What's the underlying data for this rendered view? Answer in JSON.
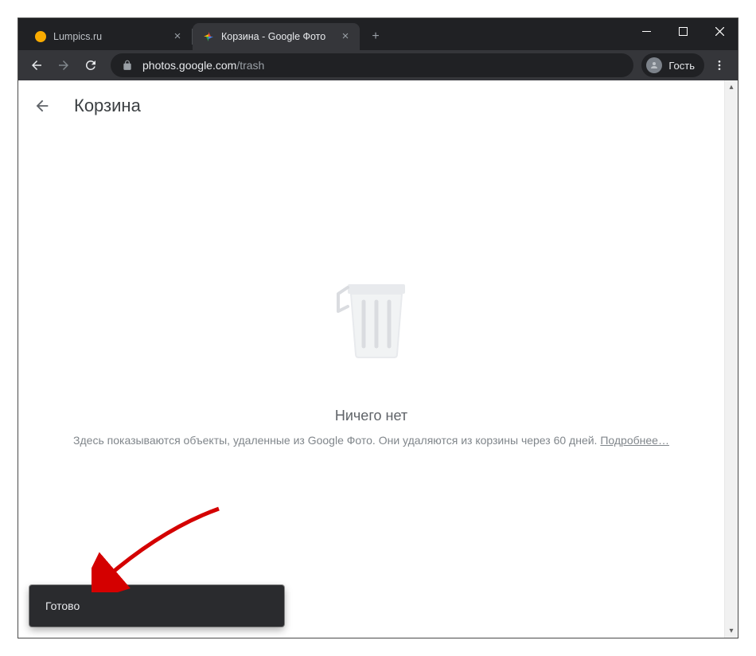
{
  "browser": {
    "tabs": [
      {
        "title": "Lumpics.ru",
        "active": false
      },
      {
        "title": "Корзина - Google Фото",
        "active": true
      }
    ],
    "address": {
      "host": "photos.google.com",
      "path": "/trash"
    },
    "profile_label": "Гость"
  },
  "page": {
    "title": "Корзина",
    "empty_title": "Ничего нет",
    "empty_subtitle": "Здесь показываются объекты, удаленные из Google Фото. Они удаляются из корзины через 60 дней. ",
    "learn_more": "Подробнее…"
  },
  "toast": {
    "message": "Готово"
  }
}
